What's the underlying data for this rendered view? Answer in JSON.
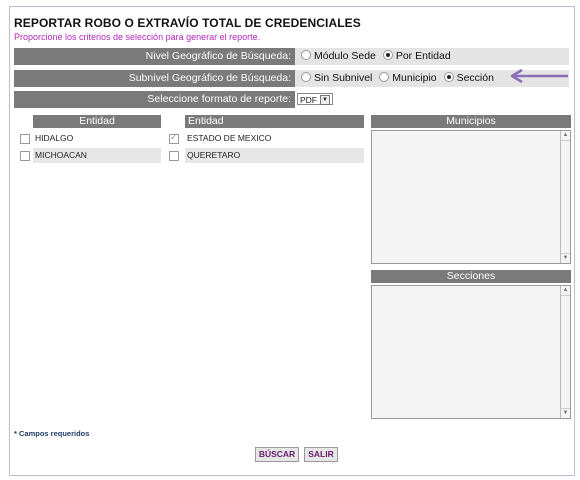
{
  "header": {
    "title": "REPORTAR ROBO O EXTRAVÍO TOTAL DE CREDENCIALES",
    "subtitle": "Proporcione los criterios de selección para generar el reporte."
  },
  "criteria": {
    "nivel": {
      "label": "Nivel Geográfico de Búsqueda:",
      "options": [
        "Módulo Sede",
        "Por Entidad"
      ],
      "selected": "Por Entidad"
    },
    "subnivel": {
      "label": "Subnivel Geográfico de Búsqueda:",
      "options": [
        "Sin Subnivel",
        "Municipio",
        "Sección"
      ],
      "selected": "Sección"
    },
    "formato": {
      "label": "Seleccione formato de reporte:",
      "value": "PDF"
    }
  },
  "entidades": {
    "col1_header": "Entidad",
    "col2_header": "Entidad",
    "col1": [
      {
        "name": "HIDALGO",
        "checked": false
      },
      {
        "name": "MICHOACAN",
        "checked": false
      }
    ],
    "col2": [
      {
        "name": "ESTADO DE MEXICO",
        "checked": true
      },
      {
        "name": "QUERETARO",
        "checked": false
      }
    ]
  },
  "municipios": {
    "header": "Municipios"
  },
  "secciones": {
    "header": "Secciones"
  },
  "footer": {
    "required_note": "* Campos requeridos",
    "buscar_label": "BÚSCAR",
    "salir_label": "SALIR"
  },
  "colors": {
    "subtitle": "#b227b9",
    "header_bar": "#7a7a7a",
    "arrow": "#8a6fb8",
    "button_text": "#6a1b6e"
  }
}
